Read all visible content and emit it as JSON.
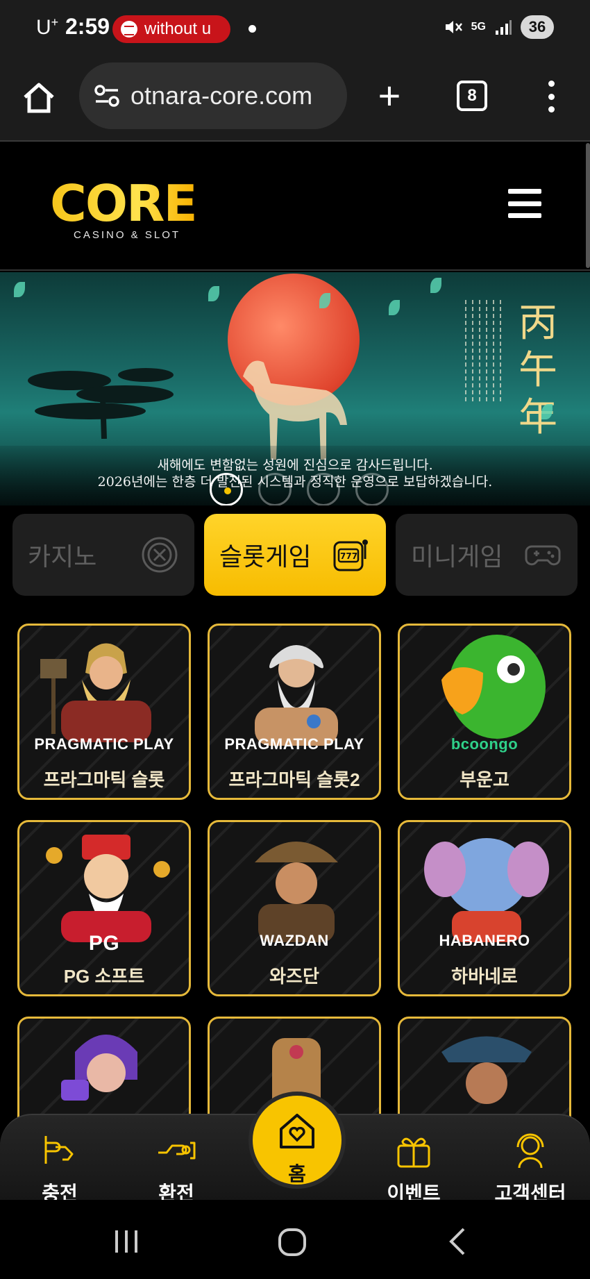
{
  "status_bar": {
    "carrier": "U",
    "carrier_sup": "+",
    "time": "2:59",
    "media_pill": "without u",
    "network": "5G",
    "battery": "36"
  },
  "browser": {
    "url": "otnara-core.com",
    "tab_count": "8"
  },
  "site": {
    "logo_word": "CORE",
    "logo_sub": "CASINO & SLOT"
  },
  "banner": {
    "hanja": "丙午年",
    "message_line1": "새해에도 변함없는 성원에 진심으로 감사드립니다.",
    "message_line2": "2026년에는 한층 더 발전된 시스템과 정직한 운영으로 보답하겠습니다.",
    "active_slide": 1,
    "slide_count": 4
  },
  "categories": [
    {
      "label": "카지노",
      "icon": "roulette-icon",
      "active": false
    },
    {
      "label": "슬롯게임",
      "icon": "slot-machine-icon",
      "active": true
    },
    {
      "label": "미니게임",
      "icon": "gamepad-icon",
      "active": false
    }
  ],
  "games": [
    {
      "brand": "PRAGMATIC PLAY",
      "name": "프라그마틱 슬롯"
    },
    {
      "brand": "PRAGMATIC PLAY",
      "name": "프라그마틱 슬롯2"
    },
    {
      "brand": "bcoongo",
      "name": "부운고"
    },
    {
      "brand": "PG",
      "name": "PG 소프트"
    },
    {
      "brand": "WAZDAN",
      "name": "와즈단"
    },
    {
      "brand": "HABANERO",
      "name": "하바네로"
    }
  ],
  "bottom_nav": {
    "deposit": "충전",
    "withdraw": "환전",
    "home": "홈",
    "event": "이벤트",
    "support": "고객센터"
  },
  "colors": {
    "accent": "#f8c400",
    "card_border": "#e6b93a"
  }
}
